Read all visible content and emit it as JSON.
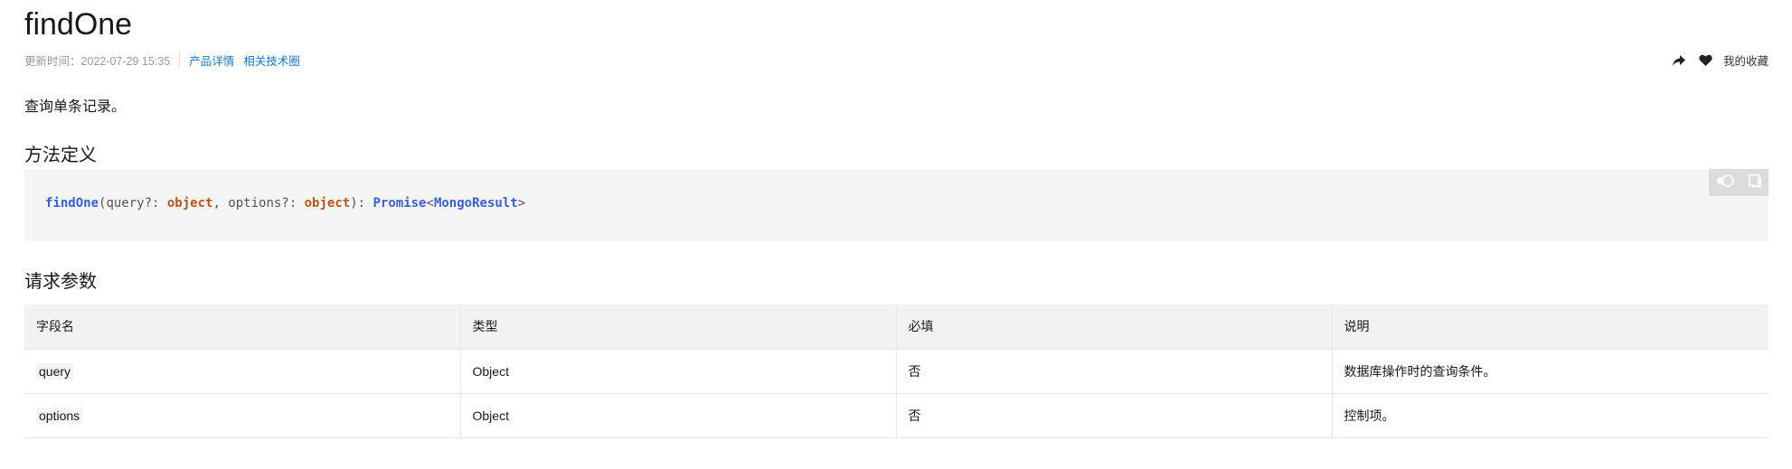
{
  "page": {
    "title": "findOne",
    "meta": {
      "updated": "更新时间：2022-07-29 15:35",
      "product_link": "产品详情",
      "community_link": "相关技术圈"
    },
    "actions": {
      "favorites_label": "我的收藏"
    },
    "description": "查询单条记录。"
  },
  "sections": {
    "method_heading": "方法定义",
    "params_heading": "请求参数"
  },
  "code": {
    "fn_name": "findOne",
    "p1": "(query?: ",
    "kw1": "object",
    "p2": ", options?: ",
    "kw2": "object",
    "p3": "): ",
    "ret": "Promise",
    "lt": "<",
    "ret_type": "MongoResult",
    "gt": ">"
  },
  "table": {
    "headers": [
      "字段名",
      "类型",
      "必填",
      "说明"
    ],
    "rows": [
      {
        "name": "query",
        "type": "Object",
        "required": "否",
        "desc": "数据库操作时的查询条件。"
      },
      {
        "name": "options",
        "type": "Object",
        "required": "否",
        "desc": "控制项。"
      }
    ]
  },
  "icons": {
    "share": "share-icon",
    "favorite": "heart-icon",
    "theme": "theme-toggle-icon",
    "copy": "copy-icon"
  }
}
